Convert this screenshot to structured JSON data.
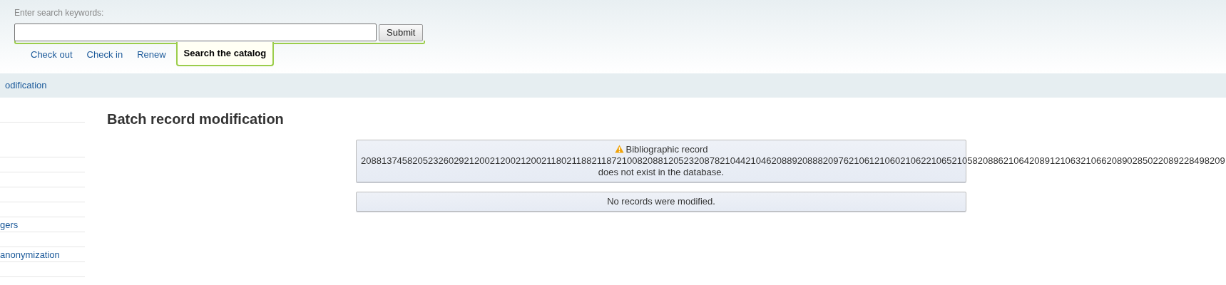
{
  "search": {
    "label": "Enter search keywords:",
    "submit": "Submit"
  },
  "tabs": [
    {
      "label": "Check out",
      "selected": false
    },
    {
      "label": "Check in",
      "selected": false
    },
    {
      "label": "Renew",
      "selected": false
    },
    {
      "label": "Search the catalog",
      "selected": true
    }
  ],
  "breadcrumb": "odification",
  "sidebar": {
    "items": [
      {
        "label": "gers"
      },
      {
        "label": "anonymization"
      }
    ]
  },
  "heading": "Batch record modification",
  "messages": [
    {
      "kind": "warning",
      "lines": [
        "Bibliographic record",
        "208813745820523260292120021200212002118021188211872100820881205232087821044210462088920888209762106121060210622106521058208862106420891210632106620890285022089228498209",
        "does not exist in the database."
      ]
    },
    {
      "kind": "info",
      "lines": [
        "No records were modified."
      ]
    }
  ]
}
